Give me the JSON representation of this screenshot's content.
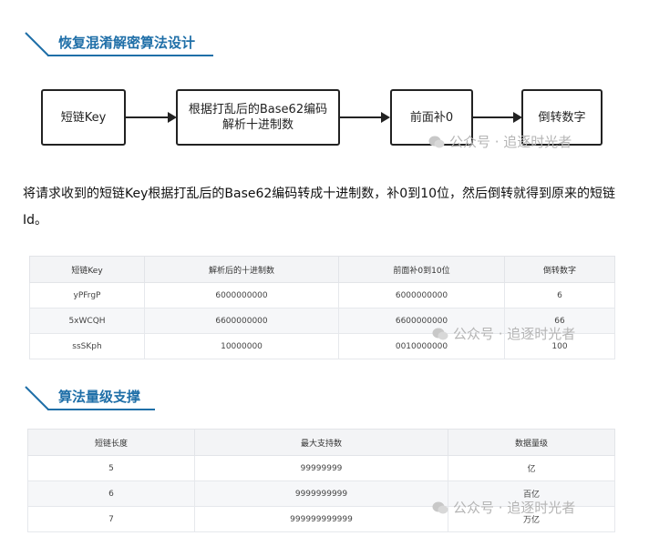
{
  "section1": {
    "title": "恢复混淆解密算法设计"
  },
  "flow": {
    "nodes": [
      "短链Key",
      "根据打乱后的Base62编码\n解析十进制数",
      "前面补0",
      "倒转数字"
    ]
  },
  "paragraph": "将请求收到的短链Key根据打乱后的Base62编码转成十进制数，补0到10位，然后倒转就得到原来的短链Id。",
  "table1": {
    "headers": [
      "短链Key",
      "解析后的十进制数",
      "前面补0到10位",
      "倒转数字"
    ],
    "rows": [
      [
        "yPFrgP",
        "6000000000",
        "6000000000",
        "6"
      ],
      [
        "5xWCQH",
        "6600000000",
        "6600000000",
        "66"
      ],
      [
        "ssSKph",
        "10000000",
        "0010000000",
        "100"
      ]
    ]
  },
  "section2": {
    "title": "算法量级支撑"
  },
  "table2": {
    "headers": [
      "短链长度",
      "最大支持数",
      "数据量级"
    ],
    "rows": [
      [
        "5",
        "99999999",
        "亿"
      ],
      [
        "6",
        "9999999999",
        "百亿"
      ],
      [
        "7",
        "999999999999",
        "万亿"
      ]
    ]
  },
  "watermark": "公众号 · 追逐时光者",
  "colors": {
    "heading": "#1f6fa8",
    "box_border": "#222222",
    "table_header_bg": "#f3f4f6"
  }
}
